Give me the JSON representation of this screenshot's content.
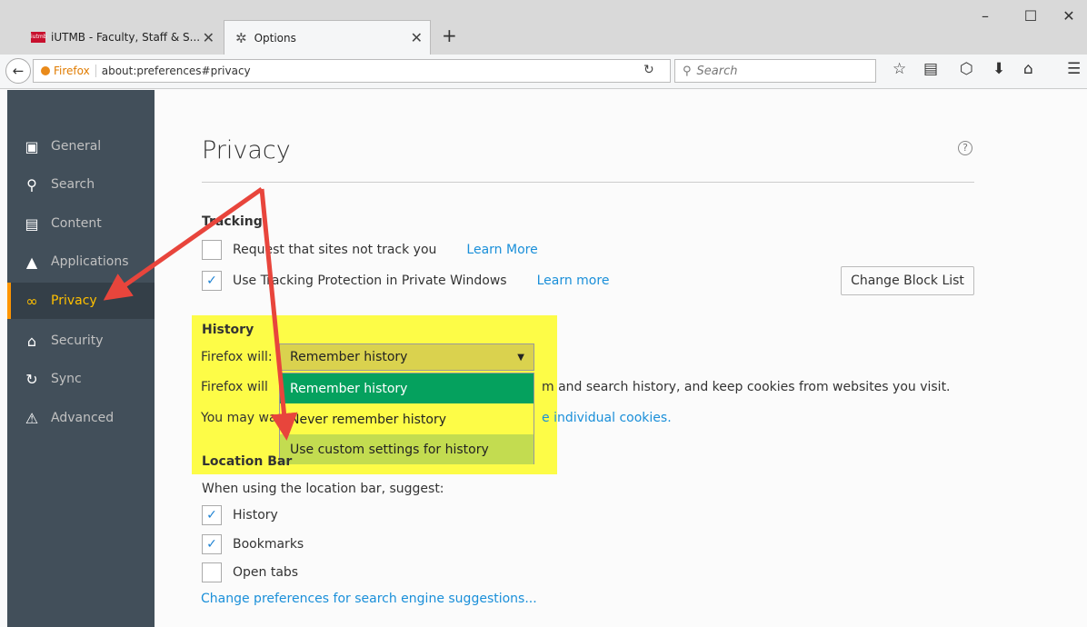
{
  "browser": {
    "tabs": [
      {
        "title": "iUTMB - Faculty, Staff & S...",
        "favicon_text": "iutmb"
      },
      {
        "title": "Options"
      }
    ],
    "new_tab_symbol": "+",
    "window_controls": {
      "minimize": "–",
      "maximize": "☐",
      "close": "✕"
    },
    "identity_label": "Firefox",
    "url": "about:preferences#privacy",
    "search_placeholder": "Search",
    "toolbar_icons": [
      "star-icon",
      "reading-list-icon",
      "pocket-icon",
      "download-icon",
      "home-icon",
      "menu-icon"
    ]
  },
  "sidebar": {
    "items": [
      {
        "label": "General",
        "icon": "general-icon"
      },
      {
        "label": "Search",
        "icon": "search-icon"
      },
      {
        "label": "Content",
        "icon": "content-icon"
      },
      {
        "label": "Applications",
        "icon": "applications-icon"
      },
      {
        "label": "Privacy",
        "icon": "privacy-mask-icon",
        "selected": true
      },
      {
        "label": "Security",
        "icon": "security-icon"
      },
      {
        "label": "Sync",
        "icon": "sync-icon"
      },
      {
        "label": "Advanced",
        "icon": "advanced-icon"
      }
    ]
  },
  "page": {
    "title": "Privacy",
    "help": "?"
  },
  "tracking": {
    "title": "Tracking",
    "do_not_track": {
      "label": "Request that sites not track you",
      "checked": false,
      "link": "Learn More"
    },
    "tracking_protection": {
      "label": "Use Tracking Protection in Private Windows",
      "checked": true,
      "link": "Learn more"
    },
    "change_block_list": "Change Block List"
  },
  "history": {
    "title": "History",
    "firefox_will_label": "Firefox will:",
    "selected": "Remember history",
    "options": [
      "Remember history",
      "Never remember history",
      "Use custom settings for history"
    ],
    "description_prefix": "Firefox will",
    "description_suffix": "m and search history, and keep cookies from websites you visit.",
    "cookies_prefix": "You may wa",
    "cookies_link": "e individual cookies."
  },
  "location_bar": {
    "title": "Location Bar",
    "suggest_label": "When using the location bar, suggest:",
    "options": [
      {
        "label": "History",
        "checked": true
      },
      {
        "label": "Bookmarks",
        "checked": true
      },
      {
        "label": "Open tabs",
        "checked": false
      }
    ],
    "search_engine_link": "Change preferences for search engine suggestions..."
  },
  "annotation_colors": {
    "arrow": "#e8453c",
    "highlight": "#fdfc47"
  }
}
